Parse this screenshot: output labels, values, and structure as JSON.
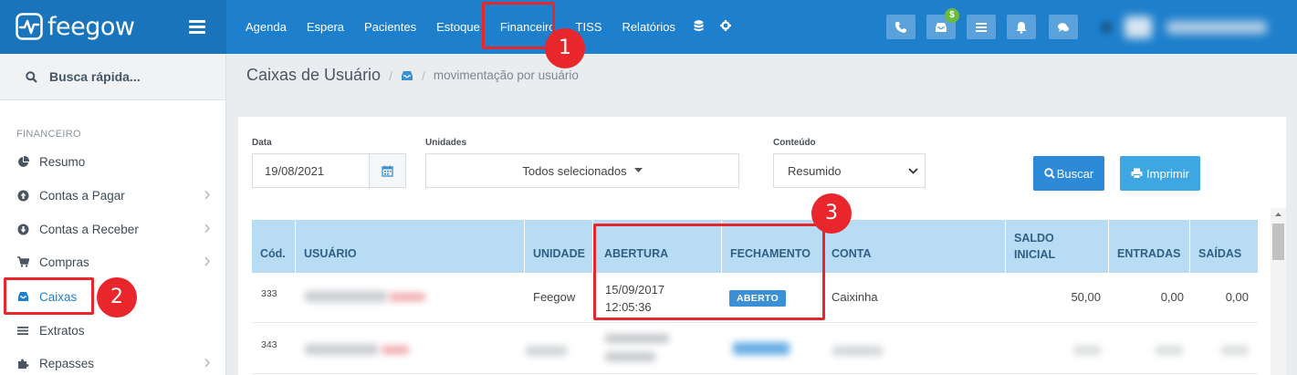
{
  "brand": {
    "name": "feegow"
  },
  "nav": [
    "Agenda",
    "Espera",
    "Pacientes",
    "Estoque",
    "Financeiro",
    "TISS",
    "Relatórios"
  ],
  "toolbar": {
    "dollar_badge": "$"
  },
  "sidebar": {
    "search_label": "Busca rápida...",
    "section_title": "FINANCEIRO",
    "items": [
      {
        "label": "Resumo",
        "icon": "pie-chart-icon"
      },
      {
        "label": "Contas a Pagar",
        "icon": "arrow-up-circle-icon"
      },
      {
        "label": "Contas a Receber",
        "icon": "arrow-down-circle-icon"
      },
      {
        "label": "Compras",
        "icon": "cart-icon"
      },
      {
        "label": "Caixas",
        "icon": "inbox-icon"
      },
      {
        "label": "Extratos",
        "icon": "list-icon"
      },
      {
        "label": "Repasses",
        "icon": "puzzle-icon"
      }
    ]
  },
  "breadcrumb": {
    "title": "Caixas de Usuário",
    "sub": "movimentação por usuário"
  },
  "filters": {
    "date_label": "Data",
    "date_value": "19/08/2021",
    "units_label": "Unidades",
    "units_value": "Todos selecionados",
    "content_label": "Conteúdo",
    "content_value": "Resumido",
    "search_button": "Buscar",
    "print_button": "Imprimir"
  },
  "table": {
    "headers": [
      "Cód.",
      "USUÁRIO",
      "UNIDADE",
      "ABERTURA",
      "FECHAMENTO",
      "CONTA",
      "SALDO INICIAL",
      "ENTRADAS",
      "SAÍDAS"
    ],
    "rows": [
      {
        "cod": "333",
        "unidade": "Feegow",
        "abertura_date": "15/09/2017",
        "abertura_time": "12:05:36",
        "status": "ABERTO",
        "conta": "Caixinha",
        "saldo": "50,00",
        "entradas": "0,00",
        "saidas": "0,00"
      },
      {
        "cod": "343"
      }
    ]
  },
  "annotations": [
    "1",
    "2",
    "3"
  ],
  "colors": {
    "topbar": "#1e7fcc",
    "accent": "#3a8fd5",
    "annotation": "#e8262b",
    "table_header": "#b8dcf3"
  }
}
